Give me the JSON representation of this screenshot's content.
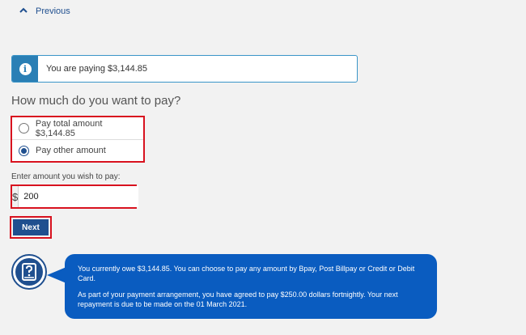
{
  "nav": {
    "previous_label": "Previous"
  },
  "info": {
    "message": "You are paying $3,144.85",
    "icon": "info-icon"
  },
  "payment": {
    "question": "How much do you want to pay?",
    "options": [
      {
        "label": "Pay total amount $3,144.85",
        "checked": false
      },
      {
        "label": "Pay other amount",
        "checked": true
      }
    ],
    "amount_label": "Enter amount you wish to pay:",
    "currency_symbol": "$",
    "amount_value": "200",
    "next_label": "Next"
  },
  "help": {
    "icon": "help-book-icon",
    "paragraph_1": "You currently owe $3,144.85. You can choose to pay any amount by Bpay, Post Billpay or Credit or Debit Card.",
    "paragraph_2": "As part of your payment arrangement, you have agreed to pay $250.00 dollars fortnightly. Your next repayment is due to be made on the 01 March 2021."
  },
  "colors": {
    "accent": "#1f4f8f",
    "info_blue": "#2a7fb5",
    "highlight_red": "#d8121f",
    "bubble_blue": "#0a5cc0"
  }
}
